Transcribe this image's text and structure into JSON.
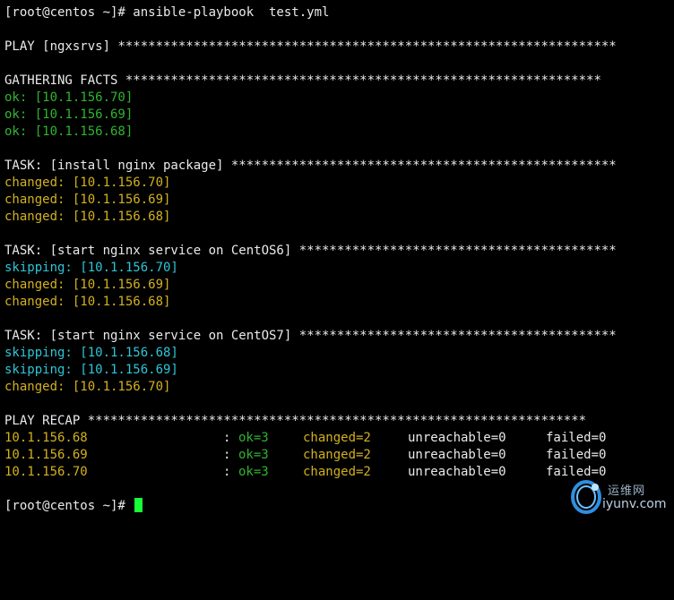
{
  "terminal": {
    "line1": "[root@centos ~]# ansible-playbook  test.yml",
    "play_header": "PLAY [ngxsrvs] ******************************************************************",
    "gather_header": "GATHERING FACTS ***************************************************************",
    "gather_ok": [
      "ok: [10.1.156.70]",
      "ok: [10.1.156.69]",
      "ok: [10.1.156.68]"
    ],
    "task1_header": "TASK: [install nginx package] ***************************************************",
    "task1_lines": [
      "changed: [10.1.156.70]",
      "changed: [10.1.156.69]",
      "changed: [10.1.156.68]"
    ],
    "task2_header": "TASK: [start nginx service on CentOS6] ******************************************",
    "task2_lines": [
      "skipping: [10.1.156.70]",
      "changed: [10.1.156.69]",
      "changed: [10.1.156.68]"
    ],
    "task3_header": "TASK: [start nginx service on CentOS7] ******************************************",
    "task3_lines": [
      "skipping: [10.1.156.68]",
      "skipping: [10.1.156.69]",
      "changed: [10.1.156.70]"
    ],
    "recap_header": "PLAY RECAP ******************************************************************",
    "recap": [
      {
        "host": "10.1.156.68",
        "colon": ":",
        "ok": "ok=3",
        "changed": "changed=2",
        "unreachable": "unreachable=0",
        "failed": "failed=0"
      },
      {
        "host": "10.1.156.69",
        "colon": ":",
        "ok": "ok=3",
        "changed": "changed=2",
        "unreachable": "unreachable=0",
        "failed": "failed=0"
      },
      {
        "host": "10.1.156.70",
        "colon": ":",
        "ok": "ok=3",
        "changed": "changed=2",
        "unreachable": "unreachable=0",
        "failed": "failed=0"
      }
    ],
    "prompt_end": "[root@centos ~]# ",
    "cursor_color": "#18ff38"
  },
  "watermark": {
    "top": "运维网",
    "bottom": "iyunv.com"
  },
  "colors": {
    "background": "#000000",
    "text": "#eaeaea",
    "ok": "#2fb52f",
    "changed": "#d3b11e",
    "skipping": "#2dc6d6"
  }
}
